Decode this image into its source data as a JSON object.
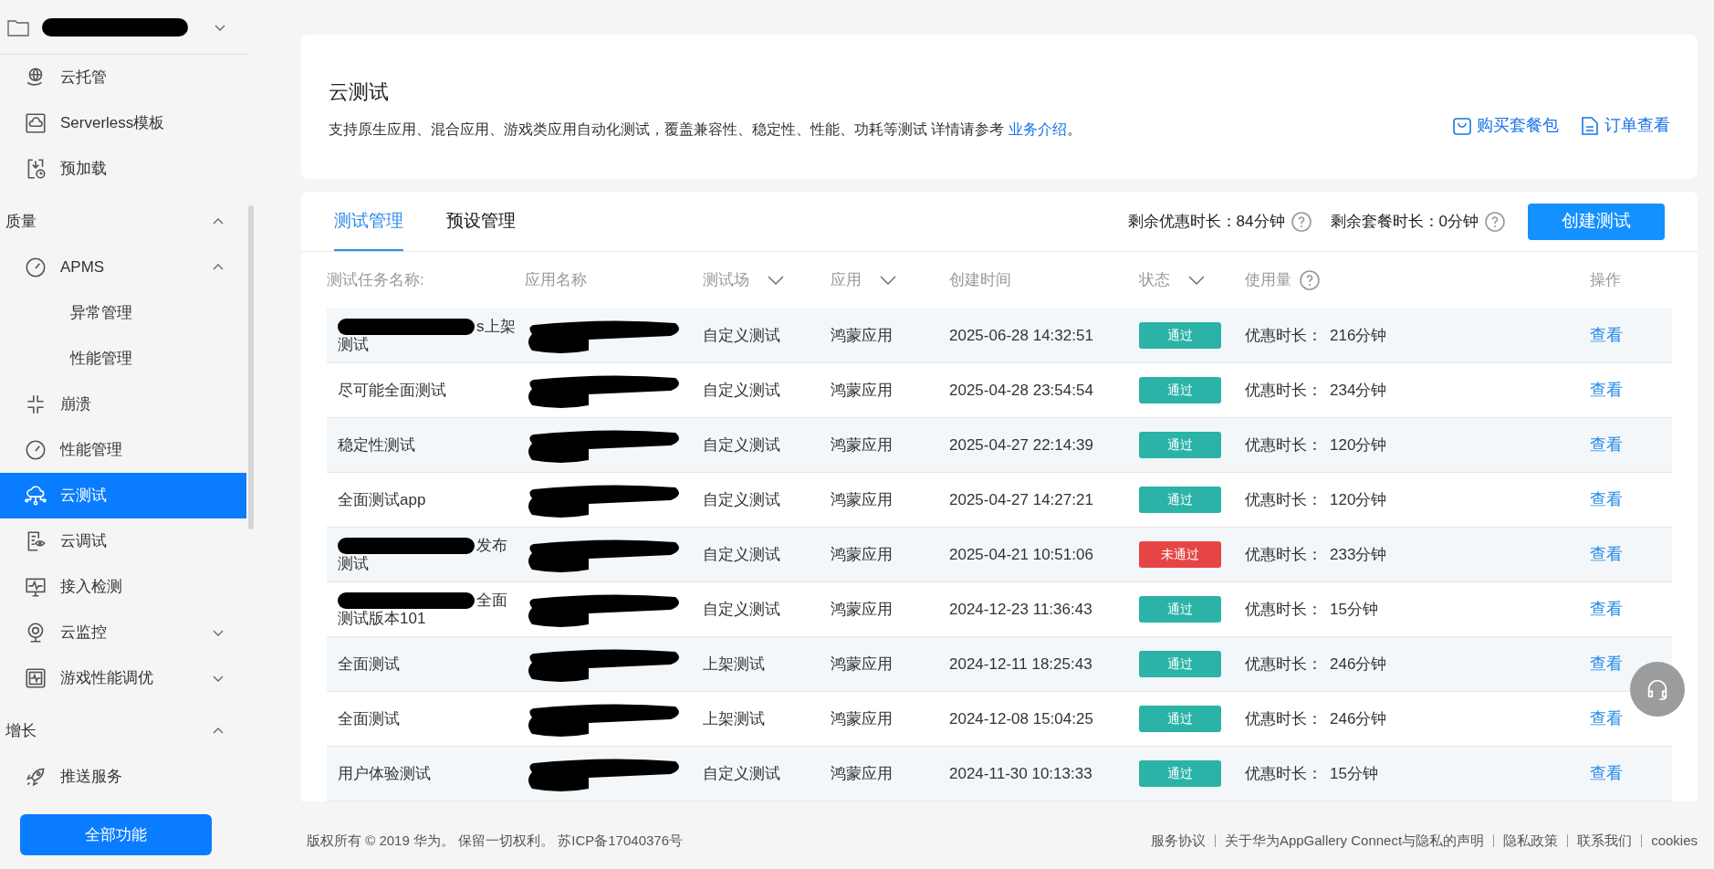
{
  "sidebar": {
    "project": {
      "redacted": true
    },
    "items": [
      {
        "kind": "item",
        "label": "云托管",
        "selected": false
      },
      {
        "kind": "item",
        "label": "Serverless模板",
        "selected": false
      },
      {
        "kind": "item",
        "label": "预加载",
        "selected": false
      },
      {
        "kind": "section",
        "label": "质量",
        "expanded": true
      },
      {
        "kind": "group",
        "label": "APMS",
        "expanded": true
      },
      {
        "kind": "sub",
        "label": "异常管理",
        "selected": false
      },
      {
        "kind": "sub",
        "label": "性能管理",
        "selected": false
      },
      {
        "kind": "item",
        "label": "崩溃",
        "selected": false
      },
      {
        "kind": "item",
        "label": "性能管理",
        "selected": false
      },
      {
        "kind": "item",
        "label": "云测试",
        "selected": true
      },
      {
        "kind": "item",
        "label": "云调试",
        "selected": false
      },
      {
        "kind": "item",
        "label": "接入检测",
        "selected": false
      },
      {
        "kind": "group",
        "label": "云监控",
        "expanded": false
      },
      {
        "kind": "group",
        "label": "游戏性能调优",
        "expanded": false
      },
      {
        "kind": "section",
        "label": "增长",
        "expanded": true
      },
      {
        "kind": "item",
        "label": "推送服务",
        "selected": false
      }
    ],
    "all_button": "全部功能"
  },
  "header": {
    "title": "云测试",
    "description": "支持原生应用、混合应用、游戏类应用自动化测试，覆盖兼容性、稳定性、性能、功耗等测试  详情请参考",
    "link": "业务介绍",
    "link_suffix": "。",
    "actions": [
      "购买套餐包",
      "订单查看"
    ]
  },
  "tabs": [
    {
      "label": "测试管理",
      "selected": true
    },
    {
      "label": "预设管理",
      "selected": false
    }
  ],
  "quota": [
    {
      "label": "剩余优惠时长：84分钟"
    },
    {
      "label": "剩余套餐时长：0分钟"
    }
  ],
  "create_button": "创建测试",
  "table": {
    "columns": [
      {
        "label": "测试任务名称:"
      },
      {
        "label": "应用名称"
      },
      {
        "label": "测试场",
        "filter": true
      },
      {
        "label": "应用",
        "filter": true
      },
      {
        "label": "创建时间"
      },
      {
        "label": "状态",
        "filter": true
      },
      {
        "label": "使用量",
        "help": true
      },
      {
        "label": "操作"
      }
    ],
    "rows": [
      {
        "name_redacted": true,
        "name": [
          "s上架",
          "测试"
        ],
        "app_redacted": true,
        "scene": "自定义测试",
        "app_type": "鸿蒙应用",
        "created": "2025-06-28 14:32:51",
        "status": {
          "kind": "pass",
          "text": "通过"
        },
        "usage_label": "优惠时长：",
        "usage": "216分钟",
        "action": "查看"
      },
      {
        "name_redacted": false,
        "name": [
          "尽可能全面测试"
        ],
        "app_redacted": true,
        "scene": "自定义测试",
        "app_type": "鸿蒙应用",
        "created": "2025-04-28 23:54:54",
        "status": {
          "kind": "pass",
          "text": "通过"
        },
        "usage_label": "优惠时长：",
        "usage": "234分钟",
        "action": "查看"
      },
      {
        "name_redacted": false,
        "name": [
          "稳定性测试"
        ],
        "app_redacted": true,
        "scene": "自定义测试",
        "app_type": "鸿蒙应用",
        "created": "2025-04-27 22:14:39",
        "status": {
          "kind": "pass",
          "text": "通过"
        },
        "usage_label": "优惠时长：",
        "usage": "120分钟",
        "action": "查看"
      },
      {
        "name_redacted": false,
        "name": [
          "全面测试app"
        ],
        "app_redacted": true,
        "scene": "自定义测试",
        "app_type": "鸿蒙应用",
        "created": "2025-04-27 14:27:21",
        "status": {
          "kind": "pass",
          "text": "通过"
        },
        "usage_label": "优惠时长：",
        "usage": "120分钟",
        "action": "查看"
      },
      {
        "name_redacted": true,
        "name": [
          "发布",
          "测试"
        ],
        "app_redacted": true,
        "scene": "自定义测试",
        "app_type": "鸿蒙应用",
        "created": "2025-04-21 10:51:06",
        "status": {
          "kind": "fail",
          "text": "未通过"
        },
        "usage_label": "优惠时长：",
        "usage": "233分钟",
        "action": "查看"
      },
      {
        "name_redacted": true,
        "name": [
          "全面",
          "测试版本101"
        ],
        "app_redacted": true,
        "scene": "自定义测试",
        "app_type": "鸿蒙应用",
        "created": "2024-12-23 11:36:43",
        "status": {
          "kind": "pass",
          "text": "通过"
        },
        "usage_label": "优惠时长：",
        "usage": "15分钟",
        "action": "查看"
      },
      {
        "name_redacted": false,
        "name": [
          "全面测试"
        ],
        "app_redacted": true,
        "scene": "上架测试",
        "app_type": "鸿蒙应用",
        "created": "2024-12-11 18:25:43",
        "status": {
          "kind": "pass",
          "text": "通过"
        },
        "usage_label": "优惠时长：",
        "usage": "246分钟",
        "action": "查看"
      },
      {
        "name_redacted": false,
        "name": [
          "全面测试"
        ],
        "app_redacted": true,
        "scene": "上架测试",
        "app_type": "鸿蒙应用",
        "created": "2024-12-08 15:04:25",
        "status": {
          "kind": "pass",
          "text": "通过"
        },
        "usage_label": "优惠时长：",
        "usage": "246分钟",
        "action": "查看"
      },
      {
        "name_redacted": false,
        "name": [
          "用户体验测试"
        ],
        "app_redacted": true,
        "scene": "自定义测试",
        "app_type": "鸿蒙应用",
        "created": "2024-11-30 10:13:33",
        "status": {
          "kind": "pass",
          "text": "通过"
        },
        "usage_label": "优惠时长：",
        "usage": "15分钟",
        "action": "查看"
      }
    ]
  },
  "footer": {
    "copyright": "版权所有 © 2019 华为。 保留一切权利。 苏ICP备17040376号",
    "links": [
      "服务协议",
      "关于华为AppGallery Connect与隐私的声明",
      "隐私政策",
      "联系我们",
      "cookies"
    ]
  }
}
